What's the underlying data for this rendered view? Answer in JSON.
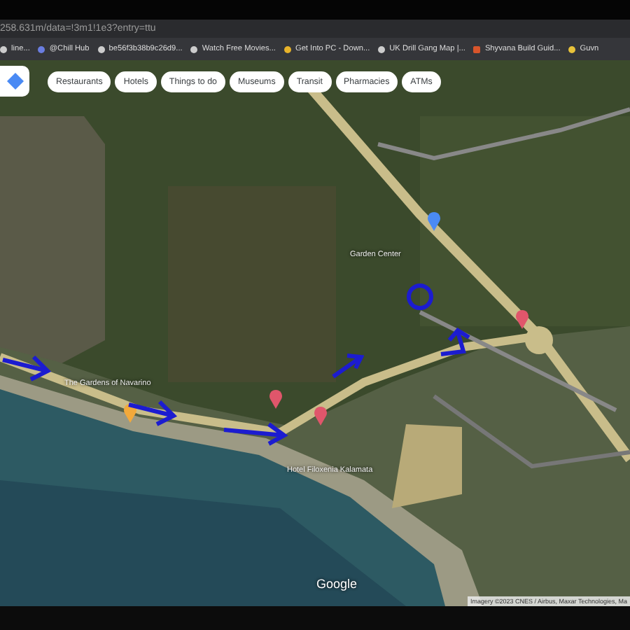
{
  "browser": {
    "url": "258.631m/data=!3m1!1e3?entry=ttu",
    "bookmarks": [
      {
        "label": "line..."
      },
      {
        "label": "@Chill Hub"
      },
      {
        "label": "be56f3b38b9c26d9..."
      },
      {
        "label": "Watch Free Movies..."
      },
      {
        "label": "Get Into PC - Down..."
      },
      {
        "label": "UK Drill Gang Map |..."
      },
      {
        "label": "Shyvana Build Guid..."
      },
      {
        "label": "Guvn"
      }
    ]
  },
  "map": {
    "chips": [
      {
        "label": "Restaurants"
      },
      {
        "label": "Hotels"
      },
      {
        "label": "Things to do"
      },
      {
        "label": "Museums"
      },
      {
        "label": "Transit"
      },
      {
        "label": "Pharmacies"
      },
      {
        "label": "ATMs"
      }
    ],
    "labels": [
      {
        "text": "The Gardens of Navarino"
      },
      {
        "text": "Garden Center"
      },
      {
        "text": "Hotel Filoxenia Kalamata"
      }
    ],
    "logo": "Google",
    "attribution": "Imagery ©2023 CNES / Airbus, Maxar Technologies, Ma"
  }
}
